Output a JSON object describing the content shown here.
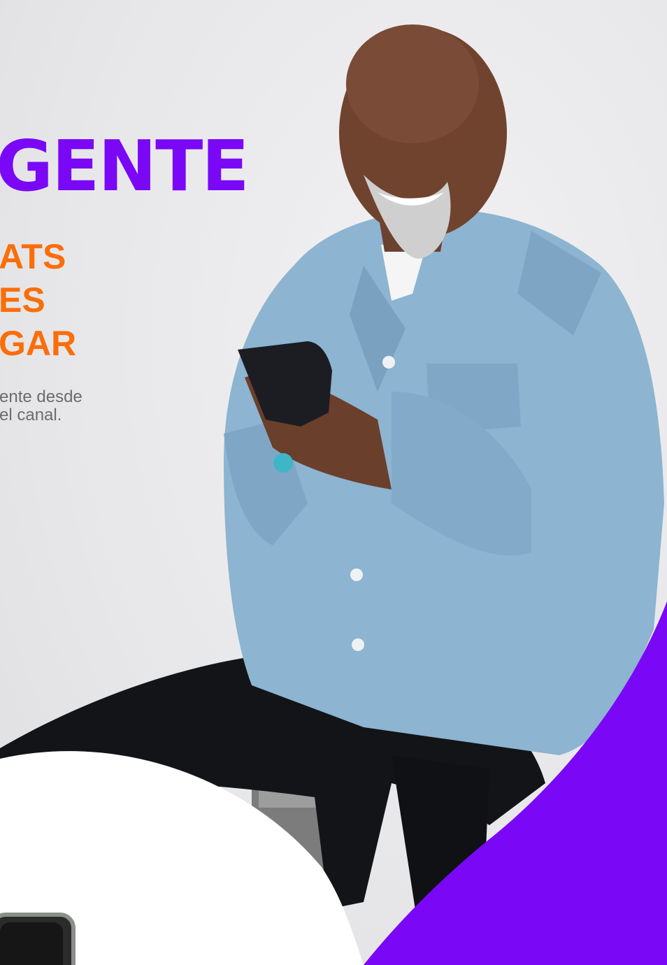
{
  "hero": {
    "headline": "GENTE",
    "subheadline_lines": [
      "ATS",
      "ES",
      "GAR"
    ],
    "body_lines": [
      "ente desde",
      "el canal."
    ]
  },
  "colors": {
    "brand_purple": "#7a08f7",
    "accent_orange": "#fa6e0a",
    "body_gray": "#6c6c6c",
    "background": "#e9e9eb"
  },
  "imagery": {
    "photo": "smiling-man-with-phone",
    "decor_shapes": [
      "purple-curve-shape",
      "white-curve-shape"
    ],
    "corner_device": "phone-device-partial"
  }
}
